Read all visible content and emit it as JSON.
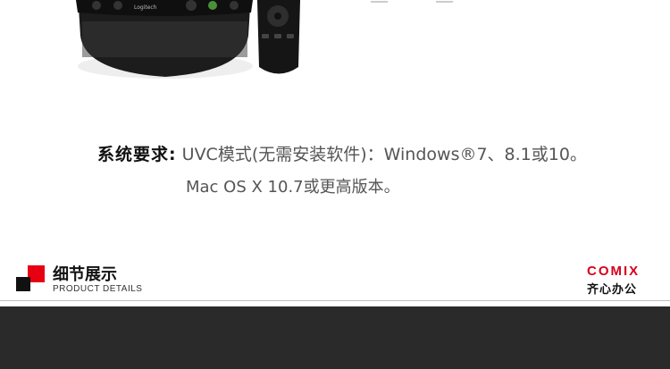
{
  "product_photo": {
    "speaker_logo_text": "Logitech"
  },
  "system_requirements": {
    "label": "系统要求:",
    "line1": "UVC模式(无需安装软件)：Windows®7、8.1或10。",
    "line2": "Mac OS X 10.7或更高版本。"
  },
  "section_header": {
    "title": "细节展示",
    "subtitle": "PRODUCT DETAILS"
  },
  "brand": {
    "wordmark": "COMIX",
    "chinese_name": "齐心办公"
  },
  "colors": {
    "accent_red": "#e60012",
    "panel_dark": "#2a2a2a"
  }
}
